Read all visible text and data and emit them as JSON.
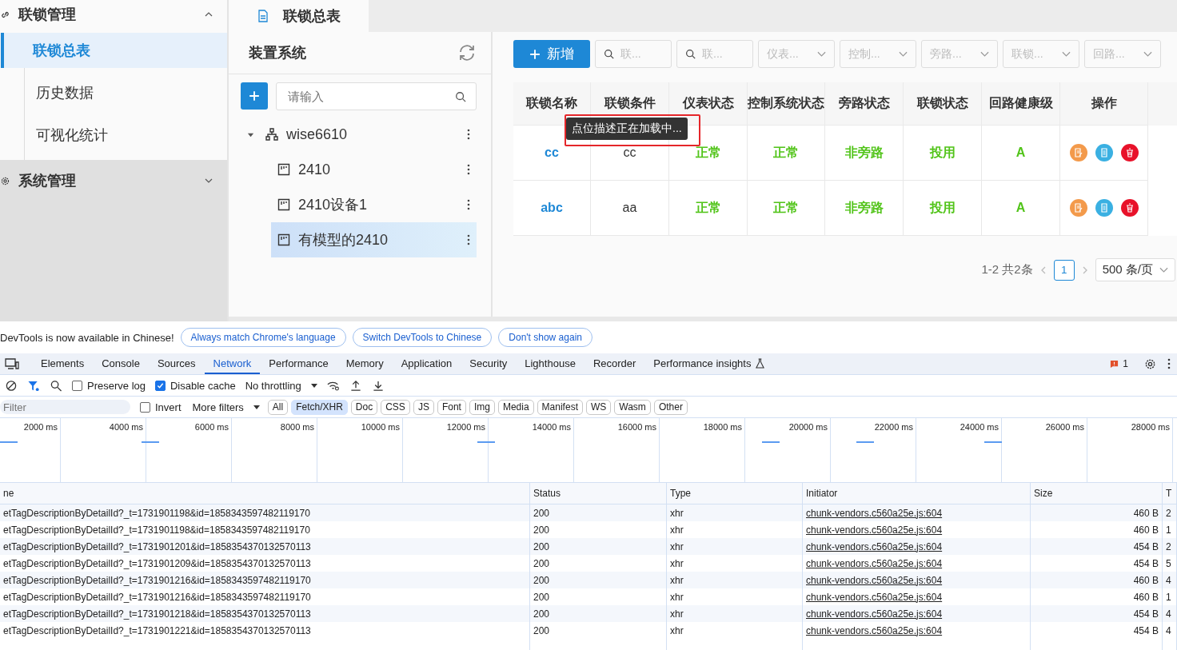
{
  "sidebar": {
    "groups": [
      {
        "label": "联锁管理",
        "expanded": true,
        "children": [
          {
            "label": "联锁总表",
            "selected": true
          },
          {
            "label": "历史数据",
            "selected": false
          },
          {
            "label": "可视化统计",
            "selected": false
          }
        ]
      },
      {
        "label": "系统管理",
        "expanded": false
      }
    ]
  },
  "page_tabs": [
    {
      "label": "联锁总表",
      "selected": true
    }
  ],
  "tree_panel": {
    "title": "装置系统",
    "search": {
      "placeholder": "请输入"
    },
    "nodes": [
      {
        "label": "wise6610",
        "kind": "group",
        "expanded": true,
        "selected": false,
        "children": [
          {
            "label": "2410",
            "kind": "device",
            "selected": false
          },
          {
            "label": "2410设备1",
            "kind": "device",
            "selected": false
          },
          {
            "label": "有模型的2410",
            "kind": "device",
            "selected": true
          }
        ]
      }
    ]
  },
  "toolbar": {
    "add_button": "新增",
    "filters": [
      {
        "kind": "search",
        "placeholder": "联..."
      },
      {
        "kind": "search",
        "placeholder": "联..."
      },
      {
        "kind": "select",
        "placeholder": "仪表..."
      },
      {
        "kind": "select",
        "placeholder": "控制..."
      },
      {
        "kind": "select",
        "placeholder": "旁路..."
      },
      {
        "kind": "select",
        "placeholder": "联锁..."
      },
      {
        "kind": "select",
        "placeholder": "回路..."
      }
    ]
  },
  "table": {
    "columns": [
      "联锁名称",
      "联锁条件",
      "仪表状态",
      "控制系统状态",
      "旁路状态",
      "联锁状态",
      "回路健康级",
      "操作"
    ],
    "rows": [
      {
        "cells": [
          "cc",
          "cc",
          "正常",
          "正常",
          "非旁路",
          "投用",
          "A"
        ]
      },
      {
        "cells": [
          "abc",
          "aa",
          "正常",
          "正常",
          "非旁路",
          "投用",
          "A"
        ]
      }
    ],
    "tooltip": "点位描述正在加载中..."
  },
  "pagination": {
    "summary": "1-2 共2条",
    "pages": [
      {
        "label": "1",
        "selected": true
      }
    ],
    "page_size": "500 条/页"
  },
  "devtools": {
    "infobar": {
      "message": "DevTools is now available in Chinese!",
      "buttons": [
        "Always match Chrome's language",
        "Switch DevTools to Chinese",
        "Don't show again"
      ]
    },
    "tabs": [
      {
        "label": "Elements",
        "selected": false
      },
      {
        "label": "Console",
        "selected": false
      },
      {
        "label": "Sources",
        "selected": false
      },
      {
        "label": "Network",
        "selected": true
      },
      {
        "label": "Performance",
        "selected": false
      },
      {
        "label": "Memory",
        "selected": false
      },
      {
        "label": "Application",
        "selected": false
      },
      {
        "label": "Security",
        "selected": false
      },
      {
        "label": "Lighthouse",
        "selected": false
      },
      {
        "label": "Recorder",
        "selected": false
      },
      {
        "label": "Performance insights",
        "selected": false
      }
    ],
    "issues_count": "1",
    "toolbar": {
      "preserve_log": {
        "label": "Preserve log",
        "checked": false
      },
      "disable_cache": {
        "label": "Disable cache",
        "checked": true
      },
      "throttling": "No throttling"
    },
    "filter_bar": {
      "placeholder": "Filter",
      "invert": {
        "label": "Invert",
        "checked": false
      },
      "more_filters": "More filters",
      "types": [
        {
          "label": "All",
          "selected": false
        },
        {
          "label": "Fetch/XHR",
          "selected": true
        },
        {
          "label": "Doc",
          "selected": false
        },
        {
          "label": "CSS",
          "selected": false
        },
        {
          "label": "JS",
          "selected": false
        },
        {
          "label": "Font",
          "selected": false
        },
        {
          "label": "Img",
          "selected": false
        },
        {
          "label": "Media",
          "selected": false
        },
        {
          "label": "Manifest",
          "selected": false
        },
        {
          "label": "WS",
          "selected": false
        },
        {
          "label": "Wasm",
          "selected": false
        },
        {
          "label": "Other",
          "selected": false
        }
      ]
    },
    "timeline_ticks": [
      "2000 ms",
      "4000 ms",
      "6000 ms",
      "8000 ms",
      "10000 ms",
      "12000 ms",
      "14000 ms",
      "16000 ms",
      "18000 ms",
      "20000 ms",
      "22000 ms",
      "24000 ms",
      "26000 ms",
      "28000 ms"
    ],
    "requests": {
      "columns": [
        "ne",
        "Status",
        "Type",
        "Initiator",
        "Size",
        "T"
      ],
      "rows": [
        [
          "etTagDescriptionByDetailId?_t=1731901198&id=1858343597482119170",
          "200",
          "xhr",
          "chunk-vendors.c560a25e.js:604",
          "460 B",
          "2"
        ],
        [
          "etTagDescriptionByDetailId?_t=1731901198&id=1858343597482119170",
          "200",
          "xhr",
          "chunk-vendors.c560a25e.js:604",
          "460 B",
          "1"
        ],
        [
          "etTagDescriptionByDetailId?_t=1731901201&id=1858354370132570113",
          "200",
          "xhr",
          "chunk-vendors.c560a25e.js:604",
          "454 B",
          "2"
        ],
        [
          "etTagDescriptionByDetailId?_t=1731901209&id=1858354370132570113",
          "200",
          "xhr",
          "chunk-vendors.c560a25e.js:604",
          "454 B",
          "5"
        ],
        [
          "etTagDescriptionByDetailId?_t=1731901216&id=1858343597482119170",
          "200",
          "xhr",
          "chunk-vendors.c560a25e.js:604",
          "460 B",
          "4"
        ],
        [
          "etTagDescriptionByDetailId?_t=1731901216&id=1858343597482119170",
          "200",
          "xhr",
          "chunk-vendors.c560a25e.js:604",
          "460 B",
          "1"
        ],
        [
          "etTagDescriptionByDetailId?_t=1731901218&id=1858354370132570113",
          "200",
          "xhr",
          "chunk-vendors.c560a25e.js:604",
          "454 B",
          "4"
        ],
        [
          "etTagDescriptionByDetailId?_t=1731901221&id=1858354370132570113",
          "200",
          "xhr",
          "chunk-vendors.c560a25e.js:604",
          "454 B",
          "4"
        ]
      ]
    }
  }
}
